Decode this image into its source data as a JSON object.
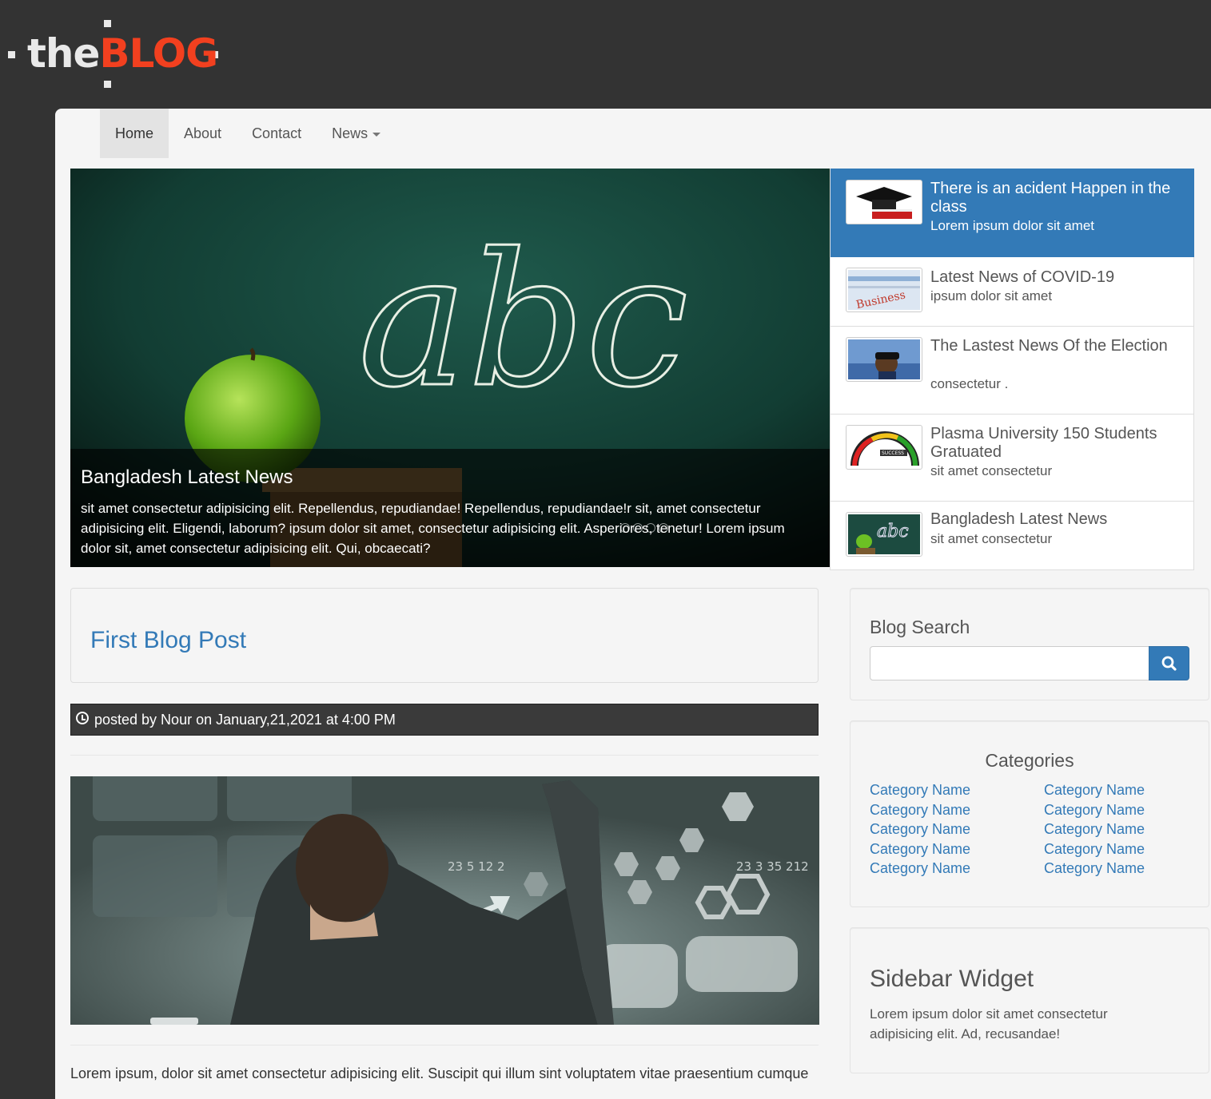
{
  "logo": {
    "part1": "the",
    "part2": "BLOG"
  },
  "nav": {
    "items": [
      {
        "label": "Home"
      },
      {
        "label": "About"
      },
      {
        "label": "Contact"
      },
      {
        "label": "News"
      }
    ]
  },
  "carousel": {
    "caption_title": "Bangladesh Latest News",
    "caption_text": "sit amet consectetur adipisicing elit. Repellendus, repudiandae! Repellendus, repudiandae!r sit, amet consectetur adipisicing elit. Eligendi, laborum? ipsum dolor sit amet, consectetur adipisicing elit. Asperiores, tenetur! Lorem ipsum dolor sit, amet consectetur adipisicing elit. Qui, obcaecati?",
    "board_text": "abc"
  },
  "news": {
    "items": [
      {
        "title": "There is an acident Happen in the class",
        "subtitle": "Lorem ipsum dolor sit amet"
      },
      {
        "title": "Latest News of COVID-19",
        "subtitle": "ipsum dolor sit amet"
      },
      {
        "title": "The Lastest News Of the Election",
        "subtitle": "consectetur ."
      },
      {
        "title": "Plasma University 150 Students Gratuated",
        "subtitle": "sit amet consectetur"
      },
      {
        "title": "Bangladesh Latest News",
        "subtitle": "sit amet consectetur"
      }
    ]
  },
  "post": {
    "title": "First Blog Post",
    "meta": "posted by Nour on January,21,2021 at 4:00 PM",
    "image_numbers_left": "23  5   12 2",
    "image_numbers_right": "23 3  35 212",
    "body": "Lorem ipsum, dolor sit amet consectetur adipisicing elit. Suscipit qui illum sint voluptatem vitae praesentium cumque"
  },
  "sidebar": {
    "search": {
      "title": "Blog Search",
      "placeholder": ""
    },
    "categories": {
      "title": "Categories",
      "left": [
        "Category Name",
        "Category Name",
        "Category Name",
        "Category Name",
        "Category Name"
      ],
      "right": [
        "Category Name",
        "Category Name",
        "Category Name",
        "Category Name",
        "Category Name"
      ]
    },
    "widget": {
      "title": "Sidebar Widget",
      "text": "Lorem ipsum dolor sit amet consectetur adipisicing elit. Ad, recusandae!"
    }
  },
  "colors": {
    "background": "#333333",
    "accent": "#337ab7",
    "logo_red": "#f2401f",
    "content_bg": "#f5f5f5"
  }
}
